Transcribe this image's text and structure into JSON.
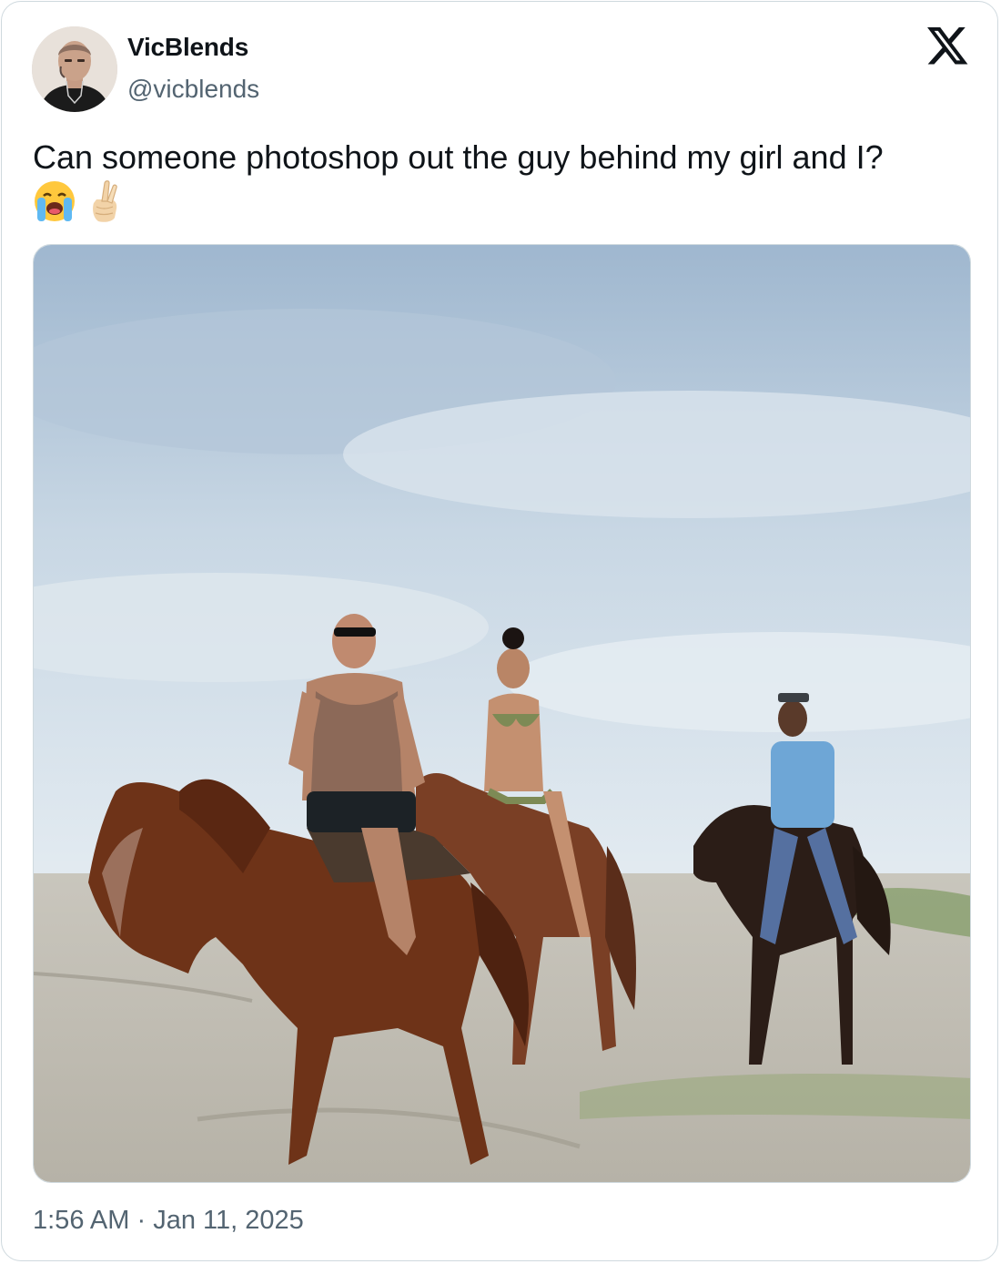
{
  "tweet": {
    "author": {
      "display_name": "VicBlends",
      "handle": "@vicblends"
    },
    "text": "Can someone photoshop out the guy behind my girl and I?",
    "emojis": [
      "loudly-crying-face-emoji",
      "crossed-fingers-emoji"
    ],
    "time": "1:56 AM",
    "separator": "·",
    "date": "Jan 11, 2025"
  },
  "icons": {
    "brand": "x-logo-icon"
  },
  "colors": {
    "text_primary": "#0f1419",
    "text_secondary": "#536471",
    "border": "#cfd9de"
  }
}
